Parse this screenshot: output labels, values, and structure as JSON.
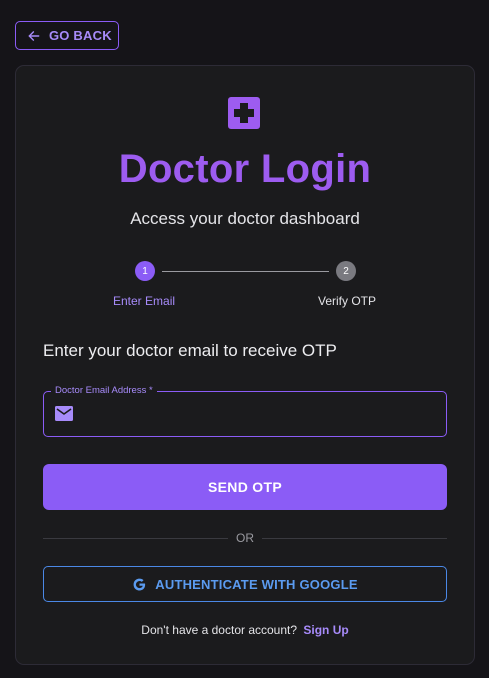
{
  "header": {
    "back_label": "GO BACK"
  },
  "card": {
    "title": "Doctor Login",
    "subtitle": "Access your doctor dashboard",
    "stepper": {
      "steps": [
        {
          "number": "1",
          "label": "Enter Email",
          "state": "active"
        },
        {
          "number": "2",
          "label": "Verify OTP",
          "state": "pending"
        }
      ]
    },
    "instruction": "Enter your doctor email to receive OTP",
    "email_field": {
      "label": "Doctor Email Address *",
      "value": "",
      "placeholder": ""
    },
    "send_otp_label": "SEND OTP",
    "divider_text": "OR",
    "google_label": "AUTHENTICATE WITH GOOGLE",
    "signup_prompt": "Don't have a doctor account?",
    "signup_link": "Sign Up"
  },
  "icons": {
    "back": "arrow-left-icon",
    "logo": "medical-cross-icon",
    "email": "mail-icon",
    "google": "google-icon"
  },
  "colors": {
    "background": "#151418",
    "card": "#1b1b1d",
    "accent": "#8b5cf6",
    "accent_light": "#a78bfa",
    "google_blue": "#5b9bf0"
  }
}
